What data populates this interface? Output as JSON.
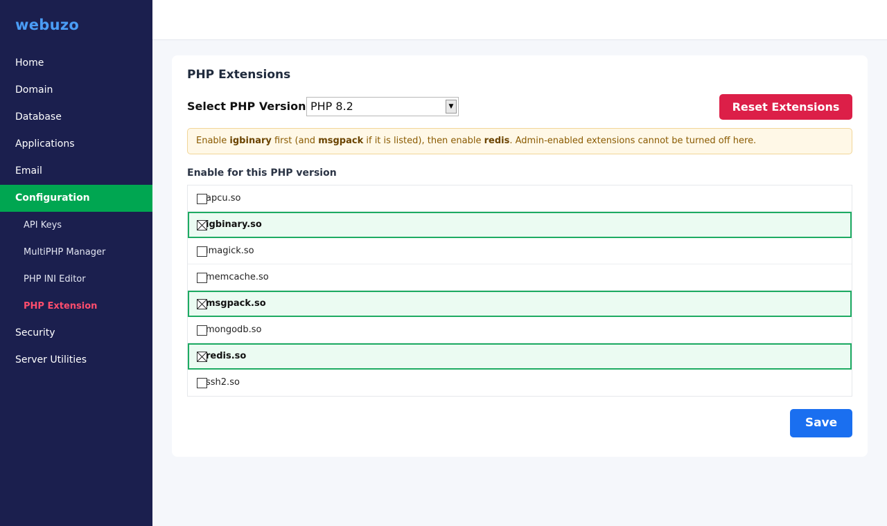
{
  "sidebar": {
    "brand": "webuzo",
    "items": [
      {
        "label": "Home"
      },
      {
        "label": "Domain"
      },
      {
        "label": "Database"
      },
      {
        "label": "Applications"
      },
      {
        "label": "Email"
      },
      {
        "label": "Configuration"
      },
      {
        "label": "API Keys"
      },
      {
        "label": "MultiPHP Manager"
      },
      {
        "label": "PHP INI Editor"
      },
      {
        "label": "PHP Extension"
      },
      {
        "label": "Security"
      },
      {
        "label": "Server Utilities"
      }
    ],
    "active_item": "Configuration",
    "current_subitem": "PHP Extension"
  },
  "main": {
    "title": "PHP Extensions",
    "version_label": "Select PHP Version",
    "version_value": "PHP 8.2",
    "reset_label": "Reset Extensions",
    "notice": {
      "t1": "Enable ",
      "b1": "igbinary",
      "t2": " first (and ",
      "b2": "msgpack",
      "t3": " if it is listed), then enable ",
      "b3": "redis",
      "t4": ". Admin-enabled extensions cannot be turned off here."
    },
    "section_label": "Enable for this PHP version",
    "extensions": [
      {
        "name": "apcu.so",
        "checked": false
      },
      {
        "name": "igbinary.so",
        "checked": true
      },
      {
        "name": "imagick.so",
        "checked": false
      },
      {
        "name": "memcache.so",
        "checked": false
      },
      {
        "name": "msgpack.so",
        "checked": true
      },
      {
        "name": "mongodb.so",
        "checked": false
      },
      {
        "name": "redis.so",
        "checked": true
      },
      {
        "name": "ssh2.so",
        "checked": false
      }
    ],
    "save_label": "Save"
  },
  "colors": {
    "sidebar_bg": "#1b1f4e",
    "brand": "#4a9cf5",
    "active_nav": "#00a651",
    "current_subitem": "#ff4d6d",
    "reset_button": "#dc1f48",
    "save_button": "#1a6ff0",
    "checked_row_border": "#1dab62",
    "checked_row_bg": "#ebfbf2",
    "notice_bg": "#fff8e7"
  }
}
